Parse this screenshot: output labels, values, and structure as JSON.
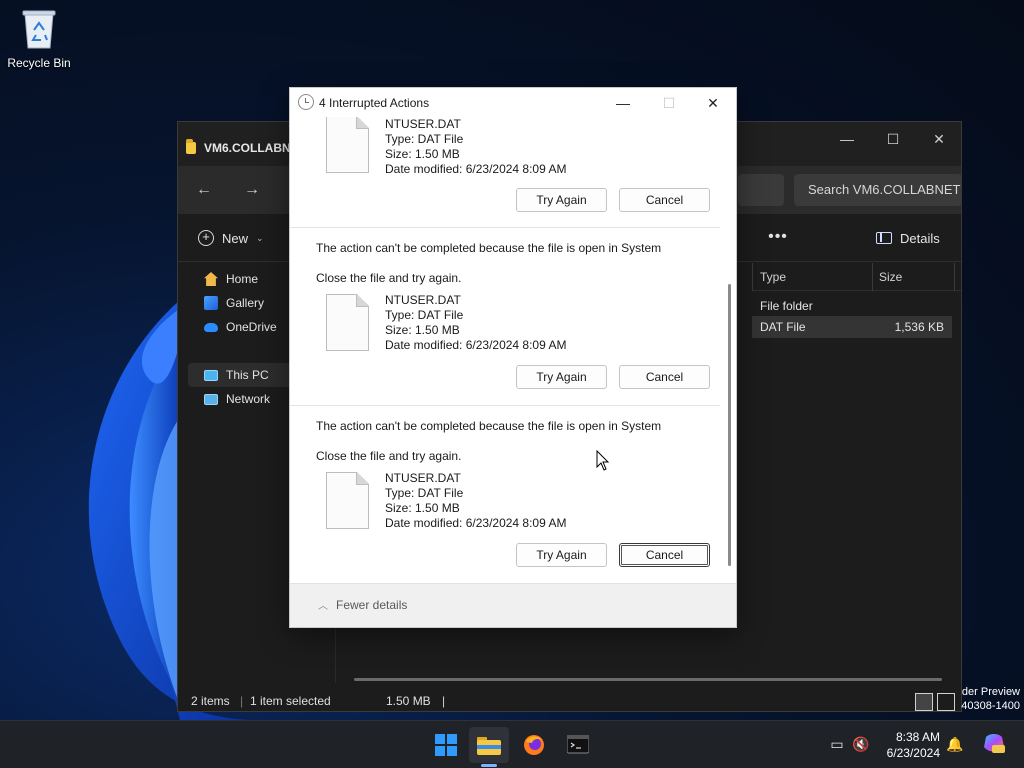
{
  "desktop": {
    "recycle_bin_label": "Recycle Bin",
    "watermark_line1": "der Preview",
    "watermark_line2": "40308-1400"
  },
  "explorer": {
    "tab_title": "VM6.COLLABNET",
    "search_placeholder": "Search VM6.COLLABNET",
    "new_label": "New",
    "more_label": "•••",
    "details_label": "Details",
    "sidebar": [
      {
        "label": "Home",
        "icon": "home-icon"
      },
      {
        "label": "Gallery",
        "icon": "gallery-icon"
      },
      {
        "label": "OneDrive",
        "icon": "onedrive-icon"
      },
      {
        "label": "This PC",
        "icon": "this-pc-icon",
        "selected": true
      },
      {
        "label": "Network",
        "icon": "network-icon"
      }
    ],
    "columns": {
      "type": "Type",
      "size": "Size"
    },
    "rows": [
      {
        "type": "File folder",
        "size": ""
      },
      {
        "type": "DAT File",
        "size": "1,536 KB",
        "selected": true
      }
    ],
    "status": {
      "items": "2 items",
      "selected": "1 item selected",
      "size": "1.50 MB"
    }
  },
  "dialog": {
    "title": "4 Interrupted Actions",
    "items": [
      {
        "message": "",
        "hint": "",
        "file_name": "NTUSER.DAT",
        "file_type": "Type: DAT File",
        "file_size": "Size: 1.50 MB",
        "file_date": "Date modified: 6/23/2024 8:09 AM",
        "try_again": "Try Again",
        "cancel": "Cancel"
      },
      {
        "message": "The action can't be completed because the file is open in System",
        "hint": "Close the file and try again.",
        "file_name": "NTUSER.DAT",
        "file_type": "Type: DAT File",
        "file_size": "Size: 1.50 MB",
        "file_date": "Date modified: 6/23/2024 8:09 AM",
        "try_again": "Try Again",
        "cancel": "Cancel"
      },
      {
        "message": "The action can't be completed because the file is open in System",
        "hint": "Close the file and try again.",
        "file_name": "NTUSER.DAT",
        "file_type": "Type: DAT File",
        "file_size": "Size: 1.50 MB",
        "file_date": "Date modified: 6/23/2024 8:09 AM",
        "try_again": "Try Again",
        "cancel": "Cancel"
      }
    ],
    "fewer_details": "Fewer details"
  },
  "taskbar": {
    "time": "8:38 AM",
    "date": "6/23/2024",
    "apps": [
      "start-icon",
      "file-explorer-icon",
      "firefox-icon",
      "terminal-icon"
    ]
  },
  "colors": {
    "accent": "#0067c0",
    "start_blue": "#2f9bff"
  }
}
